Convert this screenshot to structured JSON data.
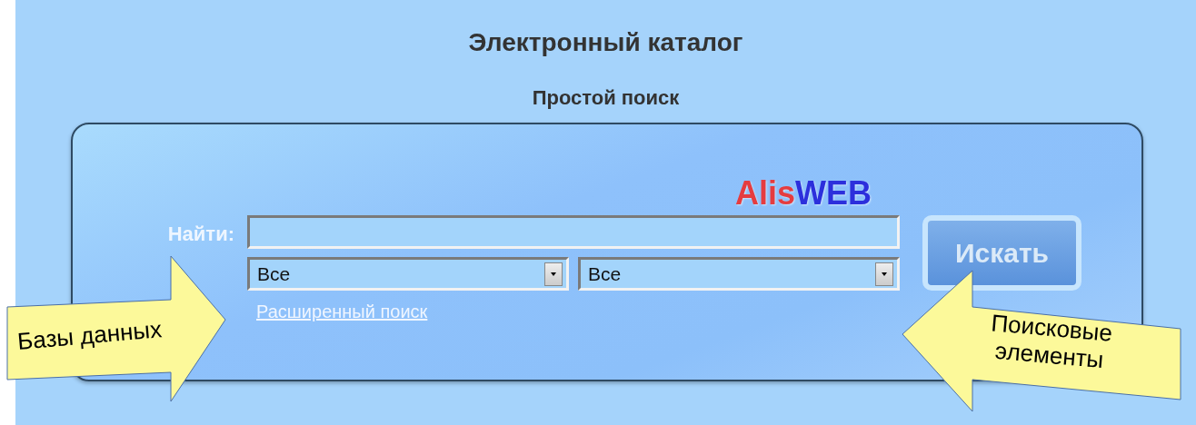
{
  "title": "Электронный каталог",
  "subtitle": "Простой поиск",
  "search_panel": {
    "logo": [
      {
        "text": "Alis",
        "color": "#e53c40"
      },
      {
        "text": "WEB",
        "color": "#2c2fdc"
      }
    ],
    "find_label": "Найти:",
    "database_select": {
      "value": "Все"
    },
    "element_select": {
      "value": "Все"
    },
    "advanced_link": "Расширенный поиск",
    "search_button": "Искать"
  },
  "callouts": [
    {
      "text": "Базы данных",
      "kind": "right"
    },
    {
      "text": "Поисковые элементы",
      "kind": "left"
    }
  ]
}
